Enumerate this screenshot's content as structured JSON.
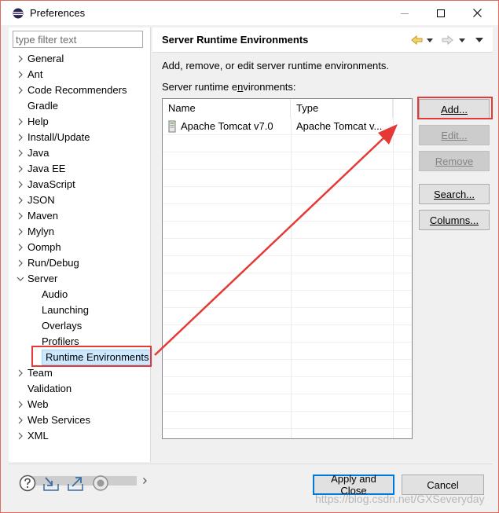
{
  "window": {
    "title": "Preferences"
  },
  "filter": {
    "placeholder": "type filter text"
  },
  "tree": [
    {
      "label": "General",
      "expandable": true,
      "level": 0
    },
    {
      "label": "Ant",
      "expandable": true,
      "level": 0
    },
    {
      "label": "Code Recommenders",
      "expandable": true,
      "level": 0
    },
    {
      "label": "Gradle",
      "expandable": false,
      "level": 0
    },
    {
      "label": "Help",
      "expandable": true,
      "level": 0
    },
    {
      "label": "Install/Update",
      "expandable": true,
      "level": 0
    },
    {
      "label": "Java",
      "expandable": true,
      "level": 0
    },
    {
      "label": "Java EE",
      "expandable": true,
      "level": 0
    },
    {
      "label": "JavaScript",
      "expandable": true,
      "level": 0
    },
    {
      "label": "JSON",
      "expandable": true,
      "level": 0
    },
    {
      "label": "Maven",
      "expandable": true,
      "level": 0
    },
    {
      "label": "Mylyn",
      "expandable": true,
      "level": 0
    },
    {
      "label": "Oomph",
      "expandable": true,
      "level": 0
    },
    {
      "label": "Run/Debug",
      "expandable": true,
      "level": 0
    },
    {
      "label": "Server",
      "expandable": true,
      "expanded": true,
      "level": 0
    },
    {
      "label": "Audio",
      "expandable": false,
      "level": 1
    },
    {
      "label": "Launching",
      "expandable": false,
      "level": 1
    },
    {
      "label": "Overlays",
      "expandable": false,
      "level": 1
    },
    {
      "label": "Profilers",
      "expandable": false,
      "level": 1
    },
    {
      "label": "Runtime Environments",
      "expandable": false,
      "level": 1,
      "selected": true
    },
    {
      "label": "Team",
      "expandable": true,
      "level": 0
    },
    {
      "label": "Validation",
      "expandable": false,
      "level": 0
    },
    {
      "label": "Web",
      "expandable": true,
      "level": 0
    },
    {
      "label": "Web Services",
      "expandable": true,
      "level": 0
    },
    {
      "label": "XML",
      "expandable": true,
      "level": 0
    }
  ],
  "page": {
    "title": "Server Runtime Environments",
    "description": "Add, remove, or edit server runtime environments.",
    "list_label": "Server runtime environments:"
  },
  "table": {
    "columns": [
      "Name",
      "Type"
    ],
    "rows": [
      {
        "name": "Apache Tomcat v7.0",
        "type": "Apache Tomcat v..."
      }
    ]
  },
  "buttons": {
    "add": "Add...",
    "edit": "Edit...",
    "remove": "Remove",
    "search": "Search...",
    "columns": "Columns..."
  },
  "footer": {
    "apply_close": "Apply and Close",
    "cancel": "Cancel",
    "watermark": "https://blog.csdn.net/GXSeveryday"
  },
  "colors": {
    "annotation": "#e53935",
    "selection": "#cce8ff",
    "focus": "#0078d7"
  }
}
